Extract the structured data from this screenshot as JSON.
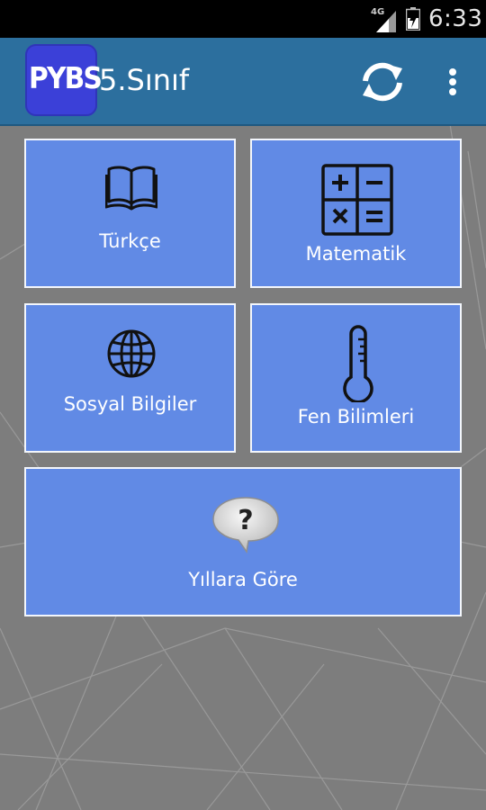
{
  "status_bar": {
    "network_label": "4G",
    "time": "6:33"
  },
  "action_bar": {
    "logo_text": "PYBS",
    "title": "5.Sınıf",
    "refresh_icon": "refresh-icon",
    "overflow_icon": "overflow-menu-icon"
  },
  "tiles": [
    {
      "label": "Türkçe",
      "icon": "book-icon"
    },
    {
      "label": "Matematik",
      "icon": "calculator-icon"
    },
    {
      "label": "Sosyal Bilgiler",
      "icon": "globe-icon"
    },
    {
      "label": "Fen Bilimleri",
      "icon": "thermometer-icon"
    },
    {
      "label": "Yıllara Göre",
      "icon": "question-bubble-icon"
    }
  ],
  "colors": {
    "status_bar": "#000000",
    "action_bar": "#2c6f9e",
    "logo_bg": "#3b40d8",
    "tile_bg": "#618ae5",
    "tile_border": "#f3f6fc",
    "background": "#7d7d7d"
  }
}
